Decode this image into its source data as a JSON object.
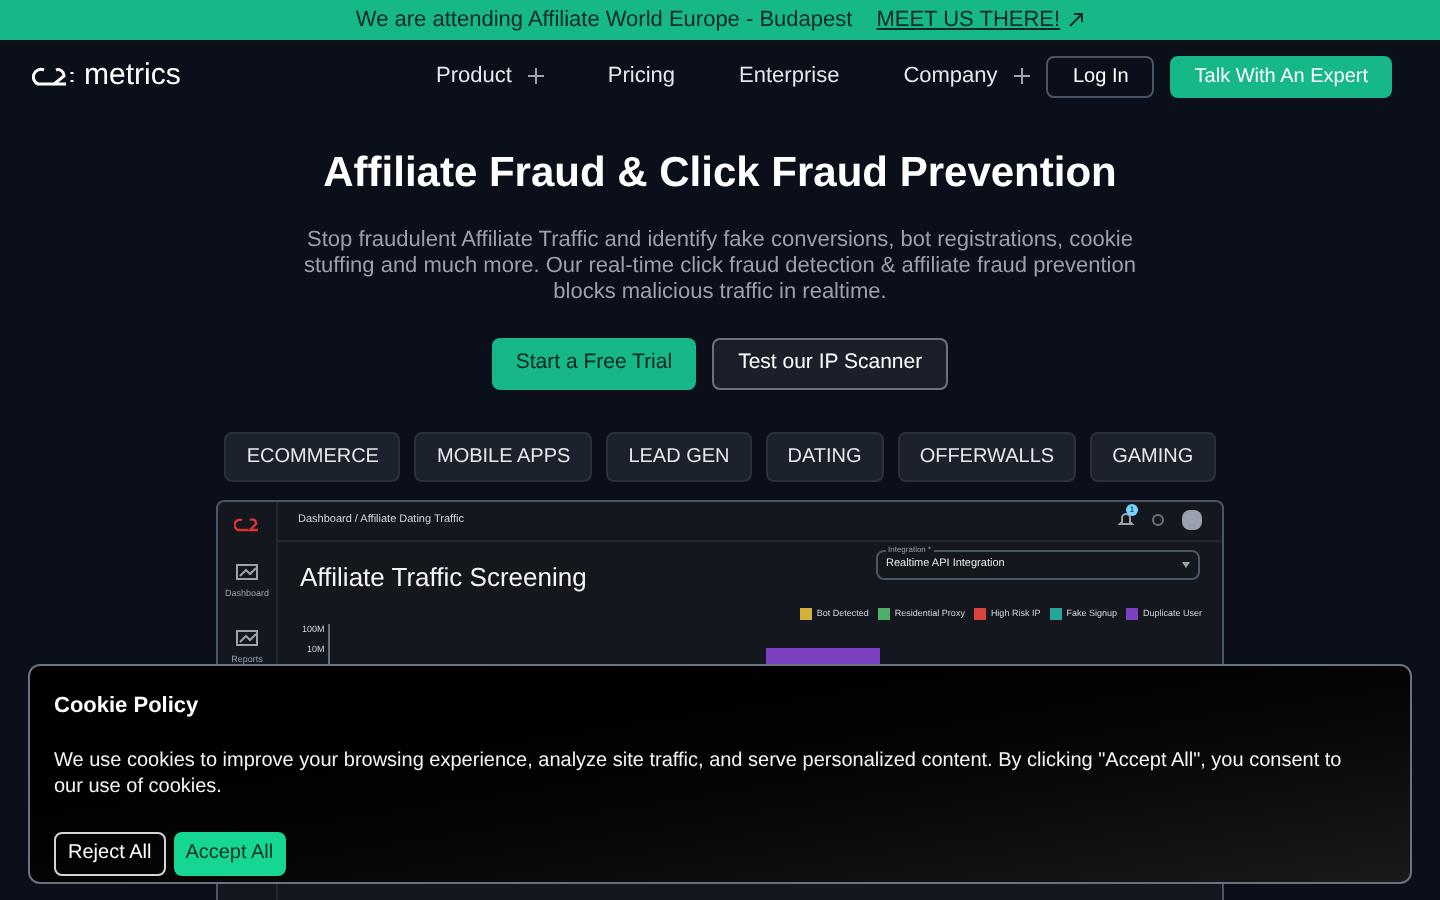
{
  "announcement": {
    "text": "We are attending Affiliate World Europe - Budapest",
    "link": "MEET US THERE!"
  },
  "nav": {
    "logo": "metrics",
    "items": [
      {
        "label": "Product",
        "expandable": true
      },
      {
        "label": "Pricing",
        "expandable": false
      },
      {
        "label": "Enterprise",
        "expandable": false
      },
      {
        "label": "Company",
        "expandable": true
      }
    ],
    "login": "Log In",
    "cta": "Talk With An Expert"
  },
  "hero": {
    "title": "Affiliate Fraud & Click Fraud Prevention",
    "description": "Stop fraudulent Affiliate Traffic and identify fake conversions, bot registrations, cookie stuffing and much more. Our real-time click fraud detection & affiliate fraud prevention blocks malicious traffic in realtime.",
    "buttons": [
      {
        "label": "Start a Free Trial",
        "kind": "primary"
      },
      {
        "label": "Test our IP Scanner",
        "kind": "secondary"
      }
    ]
  },
  "categories": [
    {
      "label": "ECOMMERCE"
    },
    {
      "label": "MOBILE APPS"
    },
    {
      "label": "LEAD GEN"
    },
    {
      "label": "DATING"
    },
    {
      "label": "OFFERWALLS"
    },
    {
      "label": "GAMING"
    }
  ],
  "dashboard": {
    "breadcrumb": [
      "Dashboard",
      "/",
      "Affiliate Dating Traffic"
    ],
    "notifications": "1",
    "sidebar": [
      {
        "label": "Dashboard"
      },
      {
        "label": "Reports"
      }
    ],
    "title": "Affiliate Traffic Screening",
    "integration": {
      "label": "Integration *",
      "value": "Realtime API Integration"
    },
    "legend": [
      {
        "label": "Bot Detected",
        "color": "#d4b03c"
      },
      {
        "label": "Residential Proxy",
        "color": "#4caf6a"
      },
      {
        "label": "High Risk IP",
        "color": "#d9443c"
      },
      {
        "label": "Fake Signup",
        "color": "#26a69a"
      },
      {
        "label": "Duplicate User",
        "color": "#7b3fc0"
      }
    ],
    "y_ticks": [
      "100M",
      "10M"
    ]
  },
  "cookie": {
    "title": "Cookie Policy",
    "text": "We use cookies to improve your browsing experience, analyze site traffic, and serve personalized content. By clicking \"Accept All\", you consent to our use of cookies.",
    "reject": "Reject All",
    "accept": "Accept All"
  }
}
